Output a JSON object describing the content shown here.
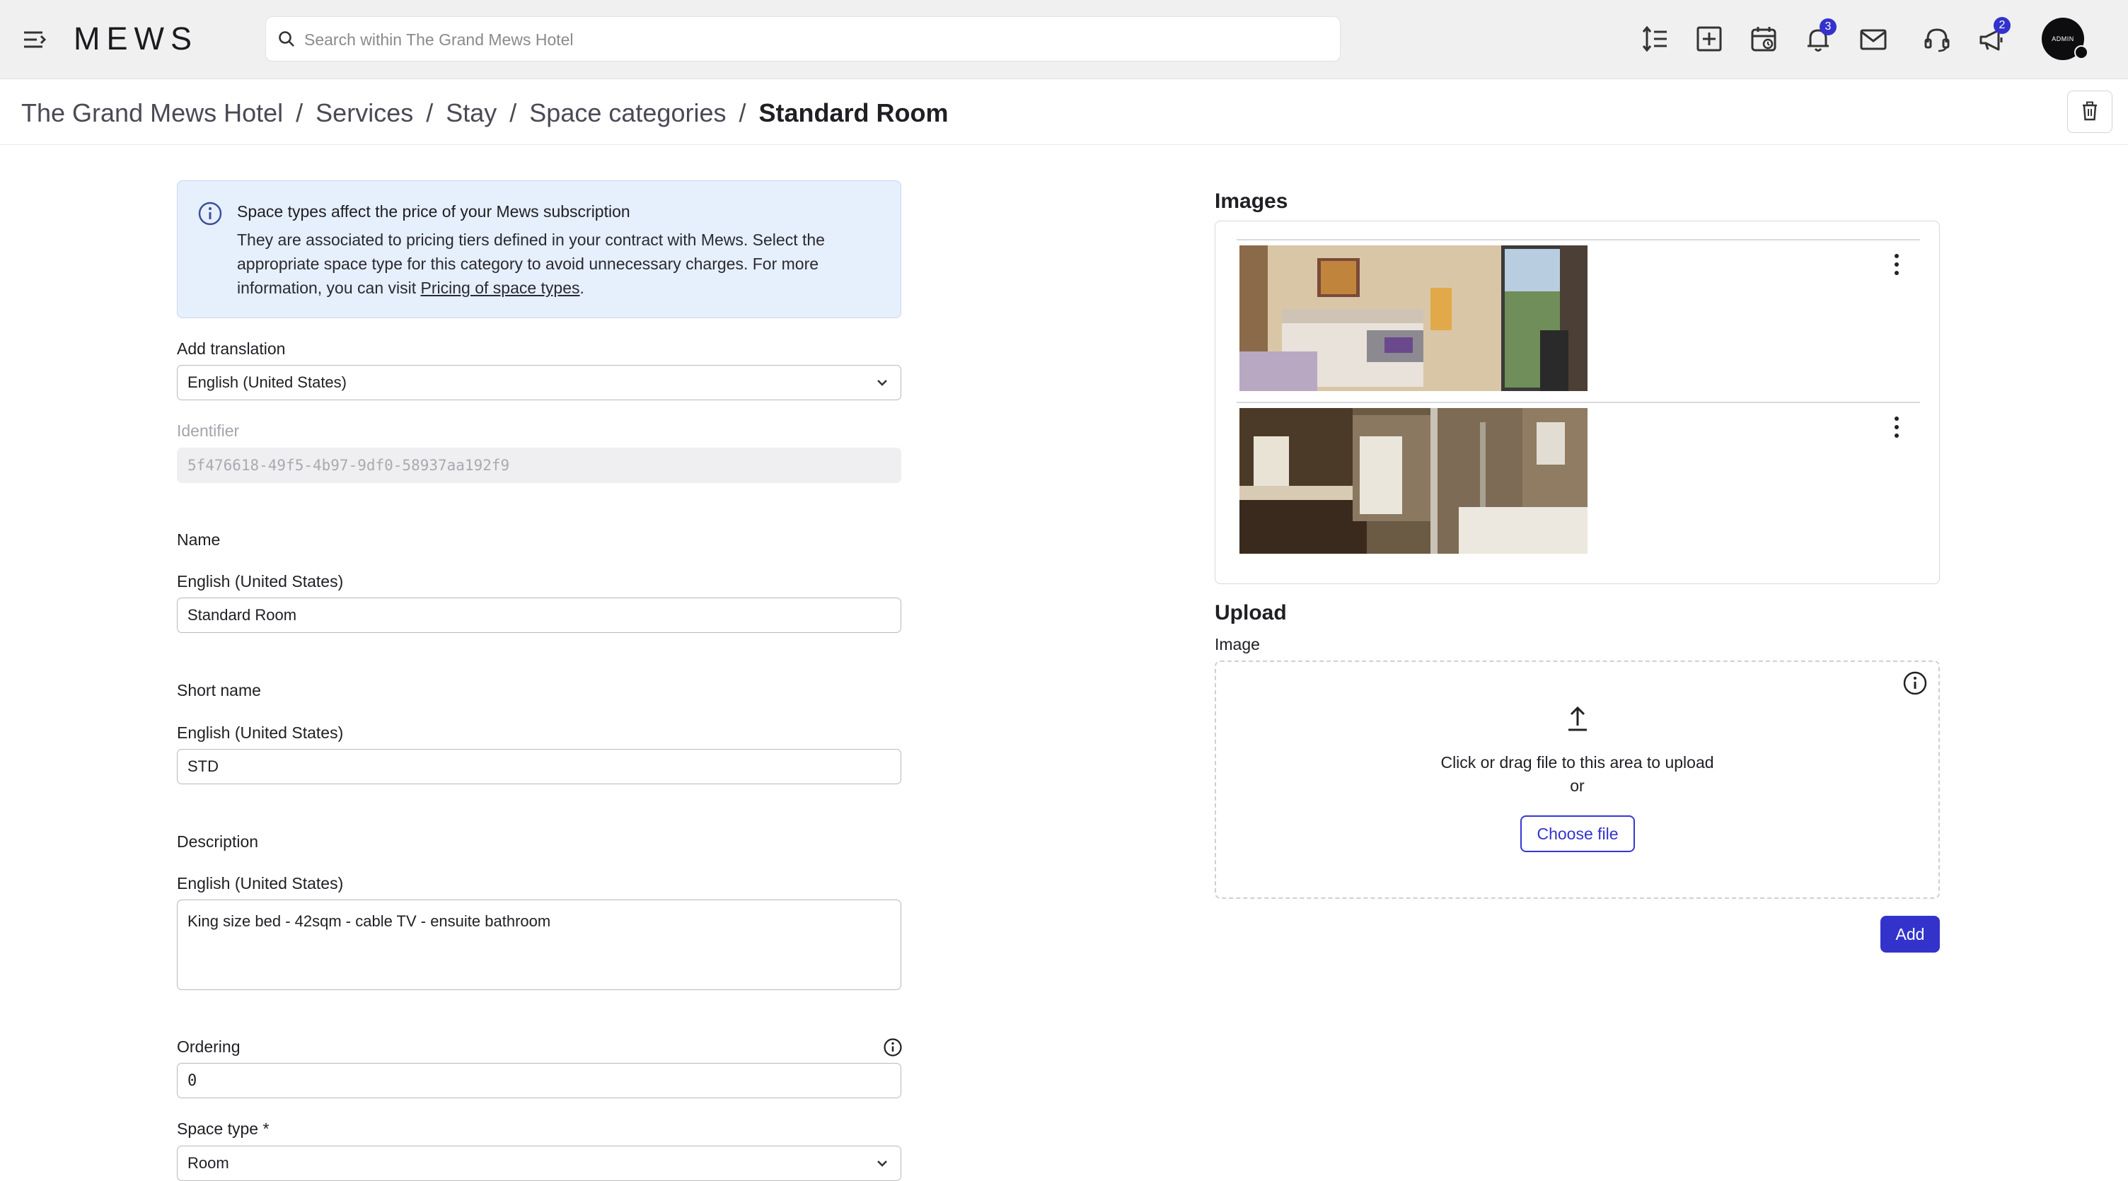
{
  "topbar": {
    "logo": "MEWS",
    "search_placeholder": "Search within The Grand Mews Hotel",
    "notifications_badge": "3",
    "announcements_badge": "2",
    "avatar_label": "ADMIN",
    "icons": [
      "menu-icon",
      "sort-icon",
      "add-square-icon",
      "calendar-icon",
      "bell-icon",
      "mail-icon",
      "headset-icon",
      "megaphone-icon"
    ]
  },
  "breadcrumb": {
    "items": [
      "The Grand Mews Hotel",
      "Services",
      "Stay",
      "Space categories"
    ],
    "current": "Standard Room",
    "separator": "/"
  },
  "info_banner": {
    "title": "Space types affect the price of your Mews subscription",
    "text_before_link": "They are associated to pricing tiers defined in your contract with Mews. Select the appropriate space type for this category to avoid unnecessary charges. For more information, you can visit ",
    "link_text": "Pricing of space types",
    "text_after_link": "."
  },
  "form": {
    "add_translation_label": "Add translation",
    "add_translation_value": "English (United States)",
    "identifier_label": "Identifier",
    "identifier_value": "5f476618-49f5-4b97-9df0-58937aa192f9",
    "name_section": "Name",
    "name_lang_label": "English (United States)",
    "name_value": "Standard Room",
    "short_name_section": "Short name",
    "short_name_lang_label": "English (United States)",
    "short_name_value": "STD",
    "description_section": "Description",
    "description_lang_label": "English (United States)",
    "description_value": "King size bed - 42sqm - cable TV - ensuite bathroom",
    "ordering_label": "Ordering",
    "ordering_value": "0",
    "space_type_label": "Space type *",
    "space_type_value": "Room"
  },
  "images": {
    "heading": "Images",
    "items": [
      {
        "name": "bedroom-photo"
      },
      {
        "name": "bathroom-photo"
      }
    ]
  },
  "upload": {
    "heading": "Upload",
    "field_label": "Image",
    "dropzone_text": "Click or drag file to this area to upload",
    "or_text": "or",
    "choose_file_label": "Choose file",
    "add_label": "Add"
  },
  "colors": {
    "accent": "#3333cc",
    "topbar_bg": "#f0f0f0",
    "info_bg": "#e6effc"
  }
}
